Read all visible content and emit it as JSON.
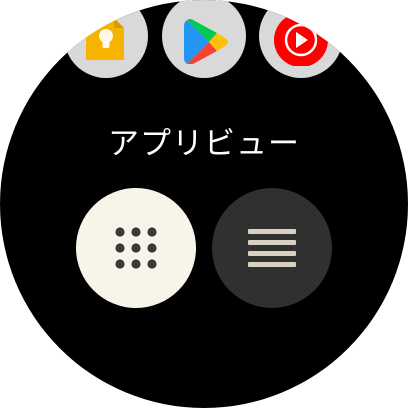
{
  "screen": {
    "title": "アプリビュー"
  },
  "apps": [
    {
      "name": "keep-notes",
      "icon": "keep-notes-icon",
      "color": "#f6b400"
    },
    {
      "name": "play-store",
      "icon": "play-store-icon"
    },
    {
      "name": "youtube-music",
      "icon": "youtube-music-icon",
      "color": "#ff0000"
    }
  ],
  "view_options": [
    {
      "id": "grid",
      "icon": "grid-dots-icon",
      "selected": true,
      "bg": "#f8f4e9",
      "fg": "#3a3a3a"
    },
    {
      "id": "list",
      "icon": "list-lines-icon",
      "selected": false,
      "bg": "#303030",
      "fg": "#d8d0c0"
    }
  ],
  "colors": {
    "background": "#000000",
    "text": "#ffffff"
  }
}
